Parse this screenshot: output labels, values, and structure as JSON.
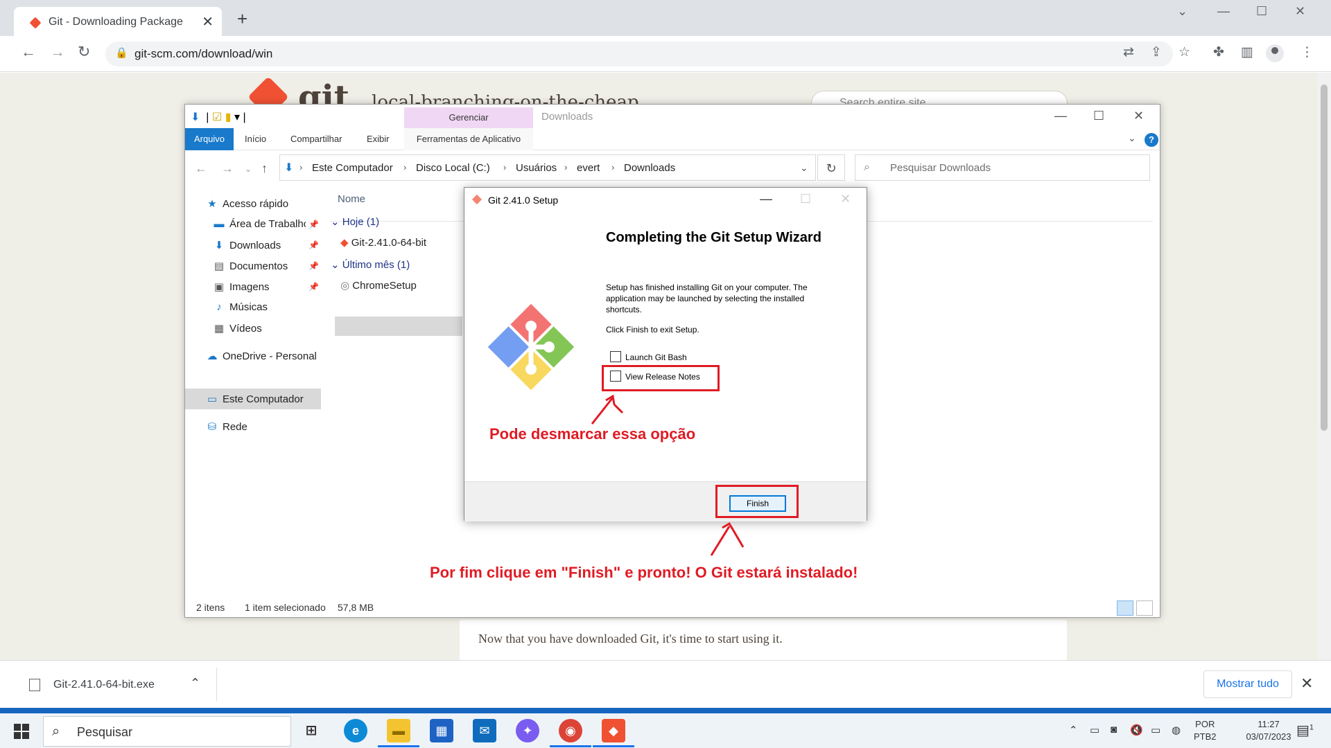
{
  "browser": {
    "tab_title": "Git - Downloading Package",
    "url": "git-scm.com/download/win",
    "new_tab": "+",
    "tab_close": "✕"
  },
  "webpage": {
    "logo_text": "git",
    "tagline": "local-branching-on-the-cheap",
    "search_placeholder": "Search entire site...",
    "content_text": "Now that you have downloaded Git, it's time to start using it."
  },
  "download_bar": {
    "file_name": "Git-2.41.0-64-bit.exe",
    "show_all": "Mostrar tudo"
  },
  "explorer": {
    "window_title": "Downloads",
    "manage_tab": "Gerenciar",
    "ribbon_tabs": [
      "Arquivo",
      "Início",
      "Compartilhar",
      "Exibir",
      "Ferramentas de Aplicativo"
    ],
    "help": "?",
    "breadcrumb": [
      "Este Computador",
      "Disco Local (C:)",
      "Usuários",
      "evert",
      "Downloads"
    ],
    "search_placeholder": "Pesquisar Downloads",
    "nav": {
      "quick_access": "Acesso rápido",
      "items": [
        "Área de Trabalho",
        "Downloads",
        "Documentos",
        "Imagens",
        "Músicas",
        "Vídeos"
      ],
      "onedrive": "OneDrive - Personal",
      "this_pc": "Este Computador",
      "network": "Rede"
    },
    "column_name": "Nome",
    "groups": [
      {
        "label": "Hoje (1)",
        "file": "Git-2.41.0-64-bit"
      },
      {
        "label": "Último mês (1)",
        "file": "ChromeSetup"
      }
    ],
    "status": {
      "count": "2 itens",
      "selected": "1 item selecionado",
      "size": "57,8 MB"
    }
  },
  "setup_dialog": {
    "title": "Git 2.41.0 Setup",
    "heading": "Completing the Git Setup Wizard",
    "body": "Setup has finished installing Git on your computer. The application may be launched by selecting the installed shortcuts.",
    "click_finish": "Click Finish to exit Setup.",
    "checkbox_launch_bash": "Launch Git Bash",
    "checkbox_release_notes": "View Release Notes",
    "launch_bash_checked": false,
    "release_notes_checked": false,
    "finish_button": "Finish"
  },
  "annotations": {
    "uncheck_hint": "Pode desmarcar essa opção",
    "finish_hint": "Por fim clique em \"Finish\" e pronto! O Git estará instalado!",
    "color": "#e01b24"
  },
  "taskbar": {
    "search_placeholder": "Pesquisar",
    "lang_line1": "POR",
    "lang_line2": "PTB2",
    "time": "11:27",
    "date": "03/07/2023",
    "notification_count": "1"
  }
}
